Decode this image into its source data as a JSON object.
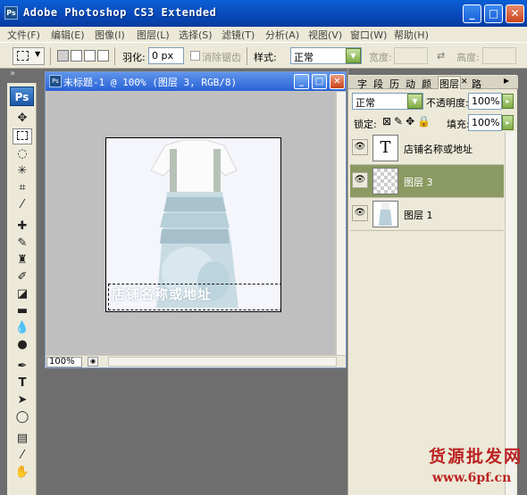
{
  "app": {
    "title": "Adobe Photoshop CS3 Extended",
    "badge": "Ps"
  },
  "window_controls": {
    "minimize": "_",
    "maximize": "□",
    "close": "✕"
  },
  "menu": [
    "文件(F)",
    "编辑(E)",
    "图像(I)",
    "图层(L)",
    "选择(S)",
    "滤镜(T)",
    "分析(A)",
    "视图(V)",
    "窗口(W)",
    "帮助(H)"
  ],
  "options": {
    "feather_label": "羽化:",
    "feather_value": "0 px",
    "antialias_label": "消除锯齿",
    "style_label": "样式:",
    "style_value": "正常",
    "width_label": "宽度:",
    "height_label": "高度:"
  },
  "toolbox": {
    "badge": "Ps",
    "tools": [
      "move-tool",
      "marquee-tool",
      "lasso-tool",
      "magic-wand-tool",
      "crop-tool",
      "eyedropper-tool",
      "healing-tool",
      "brush-tool",
      "stamp-tool",
      "history-brush-tool",
      "eraser-tool",
      "gradient-tool",
      "blur-tool",
      "dodge-tool",
      "pen-tool",
      "type-tool",
      "path-select-tool",
      "shape-tool",
      "notes-tool",
      "eyedropper-2-tool",
      "hand-tool"
    ]
  },
  "document": {
    "title": "未标题-1 @ 100% (图层 3, RGB/8)",
    "zoom": "100%",
    "canvas_text": "店铺名称或地址"
  },
  "layers_panel": {
    "tabs": [
      "字",
      "段",
      "历",
      "动",
      "颜",
      "图层",
      "路"
    ],
    "active_tab": "图层",
    "blend_mode": "正常",
    "opacity_label": "不透明度:",
    "opacity_value": "100%",
    "lock_label": "锁定:",
    "fill_label": "填充:",
    "fill_value": "100%",
    "layers": [
      {
        "name": "店铺名称或地址",
        "type_glyph": "T"
      },
      {
        "name": "图层 3"
      },
      {
        "name": "图层 1"
      }
    ]
  },
  "watermark": {
    "line1": "货源批发网",
    "line2": "www.6pf.cn"
  },
  "colors": {
    "titlebar": "#0848b8",
    "selected_layer": "#8b9a62",
    "workspace": "#6e6e6e"
  }
}
